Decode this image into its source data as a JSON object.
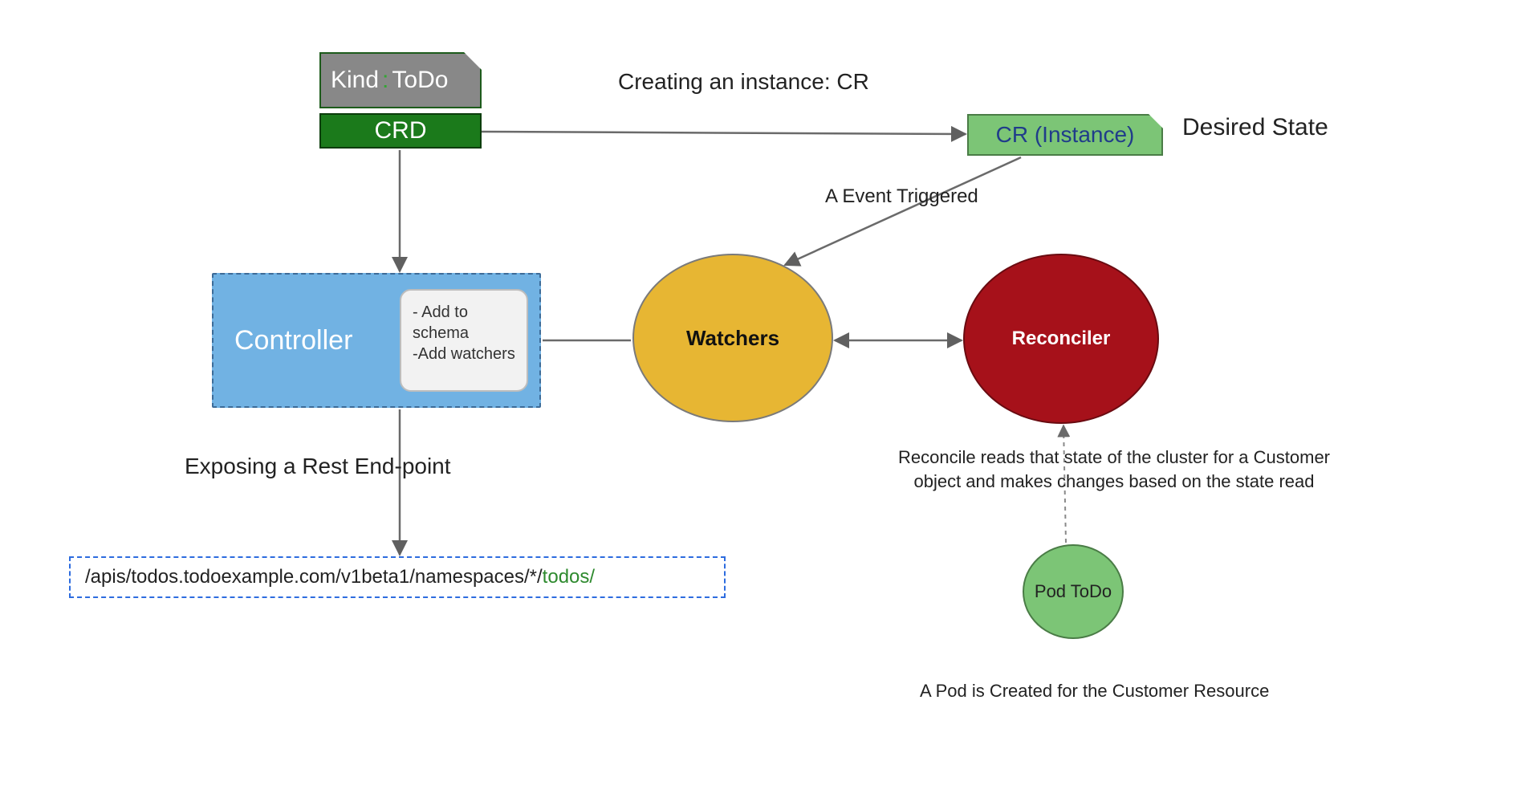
{
  "kind": {
    "key": "Kind",
    "value": "ToDo"
  },
  "crd_label": "CRD",
  "cr_instance_label": "CR (Instance)",
  "desired_state": "Desired State",
  "creating_label": "Creating an instance: CR",
  "event_label": "A Event Triggered",
  "controller": {
    "title": "Controller",
    "note1": "- Add to schema",
    "note2": "-Add watchers"
  },
  "watchers_label": "Watchers",
  "reconciler_label": "Reconciler",
  "reconcile_desc": "Reconcile reads that state of the cluster for a Customer object and makes changes based on the state read",
  "expose_label": "Exposing a Rest End-point",
  "api_path": {
    "p1": "/apis/todos.todoexample.com/v1beta1/namespaces/*/",
    "p2": "todos/"
  },
  "pod_todo": "Pod ToDo",
  "pod_desc": "A Pod is Created for the Customer Resource"
}
